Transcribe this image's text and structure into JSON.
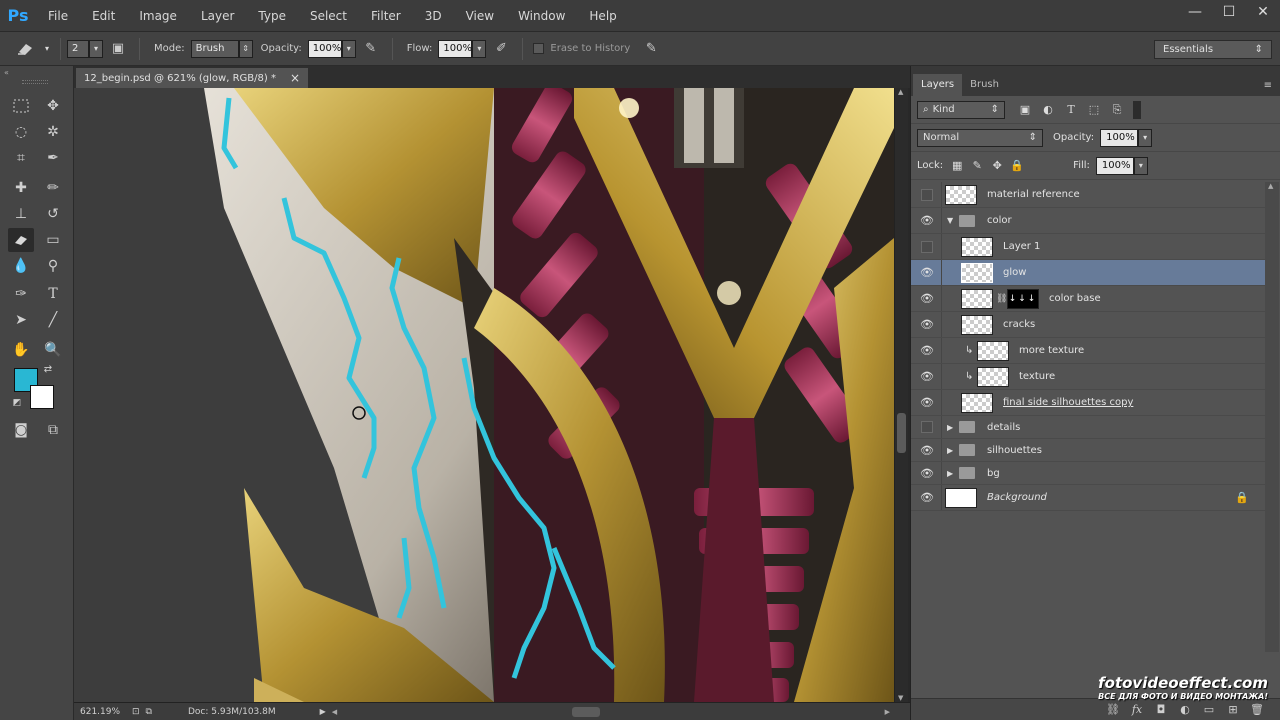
{
  "app": {
    "logo": "Ps",
    "menu": [
      "File",
      "Edit",
      "Image",
      "Layer",
      "Type",
      "Select",
      "Filter",
      "3D",
      "View",
      "Window",
      "Help"
    ],
    "window_controls": [
      "—",
      "☐",
      "✕"
    ]
  },
  "options_bar": {
    "brush_size": "2",
    "mode_label": "Mode:",
    "mode_value": "Brush",
    "opacity_label": "Opacity:",
    "opacity_value": "100%",
    "flow_label": "Flow:",
    "flow_value": "100%",
    "erase_history_label": "Erase to History",
    "workspace": "Essentials"
  },
  "document": {
    "tab_title": "12_begin.psd @ 621% (glow, RGB/8) *",
    "tab_close": "×"
  },
  "status": {
    "zoom": "621.19%",
    "doc_size": "Doc: 5.93M/103.8M"
  },
  "colors": {
    "foreground": "#29b7d3",
    "background": "#ffffff",
    "selected_layer": "#677b99"
  },
  "panel": {
    "tabs": [
      "Layers",
      "Brush"
    ],
    "filter_kind": "Kind",
    "blend_mode": "Normal",
    "opacity_label": "Opacity:",
    "opacity_value": "100%",
    "lock_label": "Lock:",
    "fill_label": "Fill:",
    "fill_value": "100%",
    "layers": [
      {
        "name": "material reference",
        "visible": false
      },
      {
        "name": "color",
        "visible": true,
        "type": "group",
        "expanded": true
      },
      {
        "name": "Layer 1",
        "visible": false
      },
      {
        "name": "glow",
        "visible": true,
        "selected": true
      },
      {
        "name": "color base",
        "visible": true,
        "mask": true,
        "mask_text": "↓↓↓"
      },
      {
        "name": "cracks",
        "visible": true
      },
      {
        "name": "more texture",
        "visible": true,
        "clipped": true
      },
      {
        "name": "texture",
        "visible": true,
        "clipped": true
      },
      {
        "name": "final side silhouettes copy",
        "visible": true
      },
      {
        "name": "details",
        "visible": false,
        "type": "group"
      },
      {
        "name": "silhouettes",
        "visible": true,
        "type": "group"
      },
      {
        "name": "bg",
        "visible": true,
        "type": "group"
      },
      {
        "name": "Background",
        "visible": true,
        "locked": true
      }
    ]
  },
  "watermark": {
    "main": "fotovideoeffect.com",
    "sub": "ВСЕ ДЛЯ ФОТО И ВИДЕО МОНТАЖА!"
  }
}
